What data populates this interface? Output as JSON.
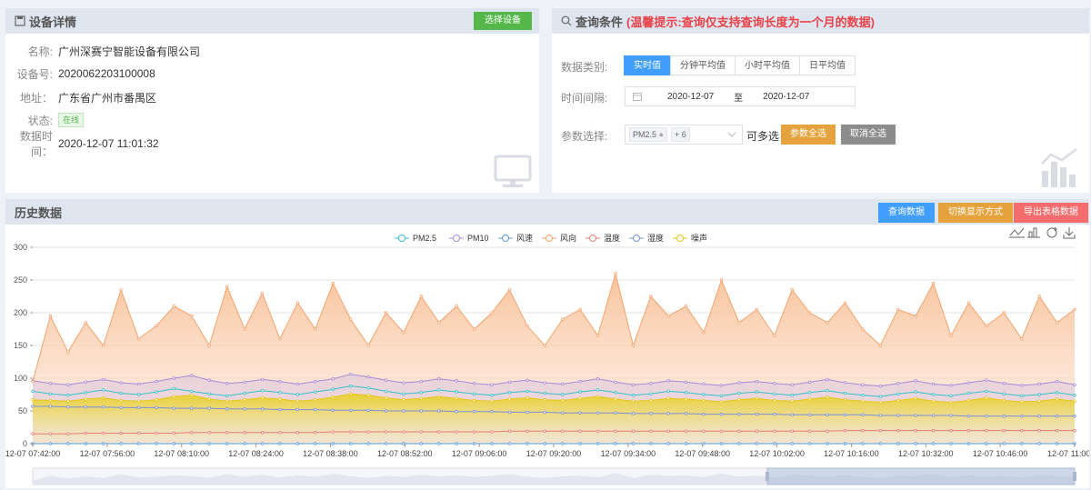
{
  "device": {
    "title": "设备详情",
    "select_label": "选择设备",
    "fields": [
      {
        "label": "名称:",
        "value": "广州深赛宁智能设备有限公司"
      },
      {
        "label": "设备号:",
        "value": "2020062203100008"
      },
      {
        "label": "地址：",
        "value": "广东省广州市番禺区"
      },
      {
        "label": "状态:",
        "value": "在线"
      },
      {
        "label": "数据时间：",
        "value": "2020-12-07 11:01:32"
      }
    ]
  },
  "query": {
    "title": "查询条件",
    "tip": "(温馨提示:查询仅支持查询长度为一个月的数据)",
    "type_label": "数据类别:",
    "types": [
      "实时值",
      "分钟平均值",
      "小时平均值",
      "日平均值"
    ],
    "interval_label": "时间间隔:",
    "start_date": "2020-12-07",
    "to_label": "至",
    "end_date": "2020-12-07",
    "param_label": "参数选择:",
    "param_tag": "PM2.5",
    "param_more": "+ 6",
    "multi_label": "可多选",
    "select_all": "参数全选",
    "clear_all": "取消全选"
  },
  "history": {
    "title": "历史数据",
    "query_btn": "查询数据",
    "switch_btn": "切换显示方式",
    "export_btn": "导出表格数据"
  },
  "colors": {
    "primary": "#409eff",
    "green": "#55b74a",
    "orange": "#e6a23c",
    "red": "#f56c6c",
    "gray": "#909399"
  },
  "chart_data": {
    "type": "area",
    "ylim": [
      0,
      300
    ],
    "yticks": [
      0,
      50,
      100,
      150,
      200,
      250,
      300
    ],
    "x_ticks": [
      "12-07 07:42:00",
      "12-07 07:56:00",
      "12-07 08:10:00",
      "12-07 08:24:00",
      "12-07 08:38:00",
      "12-07 08:52:00",
      "12-07 09:06:00",
      "12-07 09:20:00",
      "12-07 09:34:00",
      "12-07 09:48:00",
      "12-07 10:02:00",
      "12-07 10:16:00",
      "12-07 10:32:00",
      "12-07 10:46:00",
      "12-07 11:00:00"
    ],
    "x_range": [
      "07:42",
      "11:00"
    ],
    "series": [
      {
        "name": "PM2.5",
        "color": "#37c0c9",
        "values": [
          80,
          76,
          74,
          78,
          82,
          77,
          75,
          79,
          84,
          80,
          76,
          73,
          77,
          81,
          78,
          75,
          79,
          83,
          88,
          85,
          80,
          76,
          78,
          82,
          79,
          76,
          74,
          78,
          80,
          77,
          75,
          79,
          82,
          78,
          74,
          76,
          80,
          78,
          75,
          73,
          77,
          79,
          76,
          74,
          78,
          81,
          77,
          74,
          72,
          76,
          79,
          75,
          73,
          77,
          80,
          76,
          73,
          75,
          78,
          74
        ]
      },
      {
        "name": "PM10",
        "color": "#a78bd8",
        "values": [
          96,
          92,
          90,
          94,
          98,
          93,
          91,
          95,
          100,
          104,
          97,
          92,
          94,
          98,
          95,
          91,
          95,
          99,
          106,
          102,
          97,
          93,
          95,
          99,
          96,
          92,
          90,
          94,
          97,
          93,
          91,
          95,
          99,
          94,
          90,
          92,
          96,
          94,
          91,
          89,
          93,
          95,
          92,
          90,
          94,
          98,
          93,
          90,
          88,
          92,
          96,
          91,
          89,
          93,
          97,
          92,
          89,
          91,
          95,
          90
        ]
      },
      {
        "name": "风速",
        "color": "#5b9bd5",
        "values": [
          0,
          0,
          0,
          0,
          0,
          0,
          0,
          0,
          0,
          0,
          0,
          0,
          0,
          0,
          0,
          0,
          0,
          0,
          0,
          0,
          0,
          0,
          0,
          0,
          0,
          0,
          0,
          0,
          0,
          0,
          0,
          0,
          0,
          0,
          0,
          0,
          0,
          0,
          0,
          0,
          0,
          0,
          0,
          0,
          0,
          0,
          0,
          0,
          0,
          0,
          0,
          0,
          0,
          0,
          0,
          0,
          0,
          0,
          0,
          0
        ]
      },
      {
        "name": "风向",
        "color": "#f5a36c",
        "values": [
          95,
          195,
          140,
          185,
          150,
          235,
          160,
          180,
          210,
          195,
          150,
          240,
          175,
          230,
          160,
          215,
          175,
          245,
          190,
          150,
          200,
          170,
          225,
          185,
          210,
          175,
          200,
          235,
          180,
          150,
          190,
          205,
          165,
          260,
          150,
          225,
          195,
          210,
          170,
          250,
          185,
          205,
          165,
          235,
          200,
          185,
          215,
          175,
          150,
          205,
          195,
          245,
          165,
          215,
          180,
          200,
          160,
          225,
          185,
          205
        ]
      },
      {
        "name": "温度",
        "color": "#e87c7c",
        "values": [
          15,
          15,
          15,
          16,
          16,
          16,
          16,
          16,
          16,
          17,
          17,
          17,
          17,
          17,
          17,
          17,
          17,
          18,
          18,
          18,
          18,
          18,
          18,
          18,
          18,
          18,
          18,
          19,
          19,
          19,
          19,
          19,
          19,
          19,
          19,
          19,
          19,
          19,
          19,
          19,
          19,
          19,
          19,
          19,
          19,
          19,
          20,
          20,
          20,
          20,
          20,
          20,
          20,
          20,
          20,
          20,
          20,
          20,
          20,
          20
        ]
      },
      {
        "name": "湿度",
        "color": "#7b8fd9",
        "values": [
          57,
          57,
          56,
          56,
          56,
          55,
          55,
          55,
          54,
          54,
          54,
          53,
          53,
          53,
          52,
          52,
          52,
          51,
          51,
          51,
          50,
          50,
          50,
          50,
          49,
          49,
          49,
          48,
          48,
          48,
          47,
          47,
          47,
          47,
          46,
          46,
          46,
          46,
          45,
          45,
          45,
          45,
          45,
          44,
          44,
          44,
          44,
          44,
          43,
          43,
          43,
          43,
          43,
          42,
          42,
          42,
          42,
          42,
          42,
          42
        ]
      },
      {
        "name": "噪声",
        "color": "#e6c619",
        "values": [
          67,
          66,
          65,
          68,
          70,
          66,
          65,
          67,
          72,
          74,
          68,
          65,
          67,
          70,
          68,
          65,
          67,
          71,
          76,
          74,
          70,
          67,
          69,
          72,
          69,
          66,
          65,
          68,
          70,
          67,
          66,
          69,
          72,
          68,
          65,
          66,
          69,
          68,
          66,
          64,
          67,
          69,
          66,
          65,
          68,
          71,
          67,
          65,
          63,
          66,
          69,
          65,
          63,
          66,
          70,
          66,
          64,
          65,
          68,
          65
        ]
      }
    ]
  }
}
